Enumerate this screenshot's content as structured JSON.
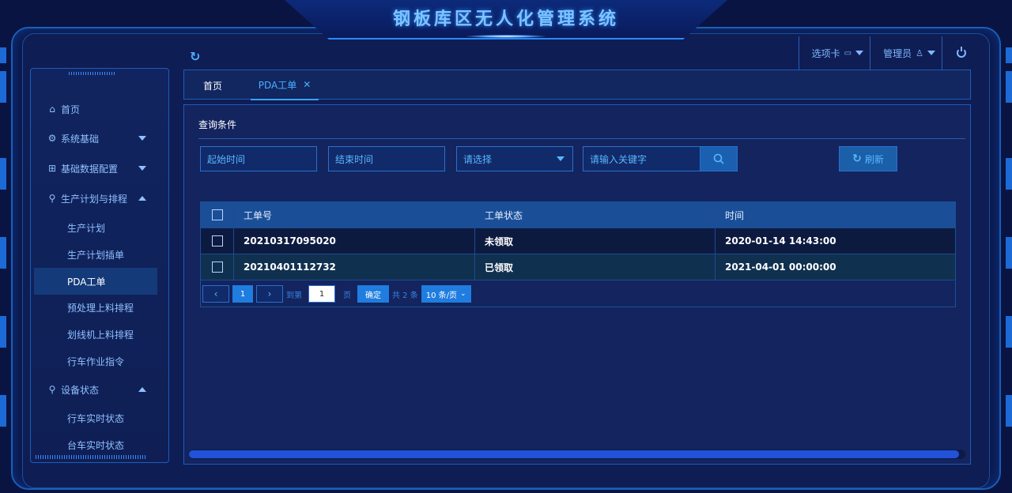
{
  "app": {
    "title": "钢板库区无人化管理系统"
  },
  "topbar": {
    "tabs_label": "选项卡",
    "user_label": "管理员"
  },
  "tabs": [
    {
      "label": "首页"
    },
    {
      "label": "PDA工单"
    }
  ],
  "sidebar": {
    "items": [
      {
        "label": "首页"
      },
      {
        "label": "系统基础"
      },
      {
        "label": "基础数据配置"
      },
      {
        "label": "生产计划与排程"
      },
      {
        "label": "生产计划"
      },
      {
        "label": "生产计划插单"
      },
      {
        "label": "PDA工单"
      },
      {
        "label": "预处理上料排程"
      },
      {
        "label": "划线机上料排程"
      },
      {
        "label": "行车作业指令"
      },
      {
        "label": "设备状态"
      },
      {
        "label": "行车实时状态"
      },
      {
        "label": "台车实时状态"
      }
    ]
  },
  "query": {
    "title": "查询条件",
    "start_placeholder": "起始时间",
    "end_placeholder": "结束时间",
    "select_placeholder": "请选择",
    "keyword_placeholder": "请输入关键字",
    "refresh_label": "刷新"
  },
  "table": {
    "headers": [
      "工单号",
      "工单状态",
      "时间"
    ],
    "rows": [
      {
        "order_no": "20210317095020",
        "status": "未领取",
        "time": "2020-01-14 14:43:00"
      },
      {
        "order_no": "20210401112732",
        "status": "已领取",
        "time": "2021-04-01 00:00:00"
      }
    ]
  },
  "pagination": {
    "current_page": "1",
    "goto_label": "到第",
    "goto_value": "1",
    "page_unit": "页",
    "confirm_label": "确定",
    "total_label": "共 2 条",
    "page_size_label": "10 条/页"
  },
  "icons": {
    "tabs": "tabs-icon",
    "user": "user-icon",
    "power": "power-icon",
    "refresh": "refresh-icon",
    "search": "search-icon",
    "home": "home-icon",
    "settings": "gear-icon",
    "grid": "grid-icon"
  },
  "colors": {
    "background": "#0a1442",
    "accent": "#3aa0ff",
    "header_row": "#1a4f98",
    "primary_button": "#1f7de0"
  }
}
